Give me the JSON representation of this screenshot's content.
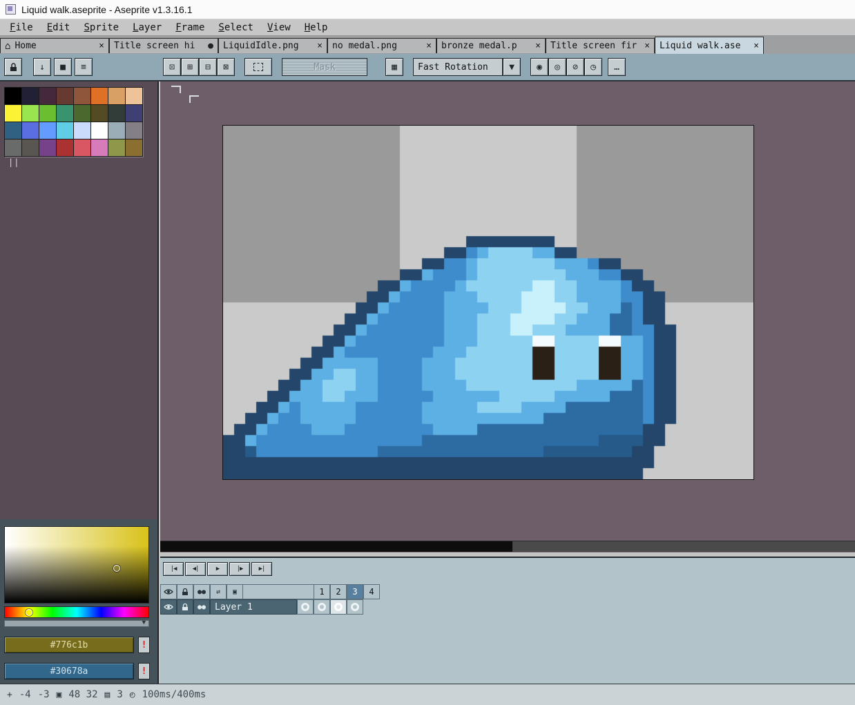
{
  "titlebar": {
    "title": "Liquid walk.aseprite - Aseprite v1.3.16.1"
  },
  "menu": {
    "items": [
      "File",
      "Edit",
      "Sprite",
      "Layer",
      "Frame",
      "Select",
      "View",
      "Help"
    ]
  },
  "tabs": [
    {
      "label": "Home",
      "icon": "⌂",
      "close": "×"
    },
    {
      "label": "Title screen hi",
      "close": "●"
    },
    {
      "label": "LiquidIdle.png",
      "close": "×"
    },
    {
      "label": "no medal.png",
      "close": "×"
    },
    {
      "label": "bronze medal.p",
      "close": "×"
    },
    {
      "label": "Title screen fir",
      "close": "×"
    },
    {
      "label": "Liquid walk.ase",
      "close": "×"
    }
  ],
  "toolbar": {
    "mask_label": "Mask",
    "rotation_value": "Fast Rotation",
    "icons": {
      "down": "↓",
      "square": "■",
      "list": "≡",
      "sel_replace": "⊡",
      "sel_add": "⊞",
      "sel_subtract": "⊟",
      "sel_intersect": "⊠",
      "grid": "▦",
      "dropdown": "▼",
      "rotate": "◉",
      "pivot": "◎",
      "no_rotate": "⊘",
      "timer": "◷",
      "more": "…"
    }
  },
  "palette": {
    "colors": [
      "#000000",
      "#222034",
      "#45283c",
      "#663931",
      "#8f563b",
      "#df7126",
      "#d9a066",
      "#eec39a",
      "#fbf236",
      "#99e550",
      "#6abe30",
      "#37946e",
      "#4b692f",
      "#524b24",
      "#323c39",
      "#3f3f74",
      "#306082",
      "#5b6ee1",
      "#639bff",
      "#5fcde4",
      "#cbdbfc",
      "#ffffff",
      "#9badb7",
      "#847e87",
      "#696a6a",
      "#595652",
      "#76428a",
      "#ac3232",
      "#d95763",
      "#d77bba",
      "#8f974a",
      "#8a6f30"
    ]
  },
  "color_selector": {
    "fg_hex": "#776c1b",
    "bg_hex": "#30678a",
    "warning": "!",
    "handle": "||",
    "resize_arrow": "▼"
  },
  "canvas": {
    "cols": 48,
    "rows": 32,
    "zoom": 16,
    "checker_tile": 16,
    "checker_dark": "#9a9a9a",
    "checker_light": "#cacaca",
    "colors": {
      "o": "#24466b",
      "d": "#2d6ba3",
      "D": "#265a88",
      "b": "#3e8ccb",
      "l": "#5cb0e4",
      "L": "#8ed2f2",
      "h": "#c9f1fb",
      "w": "#f4fbfe",
      "k": "#2b2016"
    },
    "pixels": [
      "",
      "",
      "",
      "",
      "",
      "",
      "",
      "",
      "",
      "",
      "......................oooooooo",
      "....................ooblLLLLlloo",
      "..................oobblLLLLLLLlllboo",
      "................oolbbblLLLLLLLLlllbboo",
      "..............oolbbbblLLLLLLhhLLllllboo",
      ".............oolbbbblllLLLLhhhLLllllbboo",
      "............oolbbbbbllllLLLhhhhLLllldboo",
      "...........oolbbbbbblllLLLhhhhLLlllddboo",
      "..........oolbbbbbbblllLLLhhLLLllllddbboo",
      ".........oolbbbbbbbblllLLLLLwwLLLLwwllboo",
      "........oolbbbbbbbblllLLLLLLkkLLLLkkllboo",
      ".......oolllllbbbblllLLLLLLLkkLLLLkkllboo",
      "......oollLLllbbbblllLLLLLLLkkLLLLkkllboo",
      ".....oollLLLllbbbbllllLLLLLLLLLLllllldboo",
      "....oolllLLlllbbbbbllllllLLLLLllllldddboo",
      "...oolblllllbbbbbblllllLLLLlllldddddddboo",
      "..oolbblllllbbbbbbllllllllllldddddddddboo",
      ".oolbbbblllbbbbbbbblllldddddddddddddddoo",
      "oolbbbbbbbbbbbbbbbddddddddddddddddDDDDoo",
      "ooDbbbbbbbbbbbdddddddddddddddDDDDDDDDoo",
      "ooooooooooooooooooooooooooooooooooooooo",
      "oooooooooooooooooooooooooooooooooooooo"
    ]
  },
  "timeline": {
    "playback": [
      "|◀",
      "◀|",
      "▶",
      "|▶",
      "▶|"
    ],
    "onion_icon": "●●",
    "config_icon": "⇄",
    "expand_icon": "▣",
    "frames": [
      "1",
      "2",
      "3",
      "4"
    ],
    "layer_name": "Layer 1"
  },
  "statusbar": {
    "plus": "+",
    "coord_x": "-4",
    "coord_y": "-3",
    "size_icon": "▣",
    "size": "48 32",
    "frames_icon": "▤",
    "frame_count": "3",
    "clock_icon": "◴",
    "timing": "100ms/400ms"
  }
}
